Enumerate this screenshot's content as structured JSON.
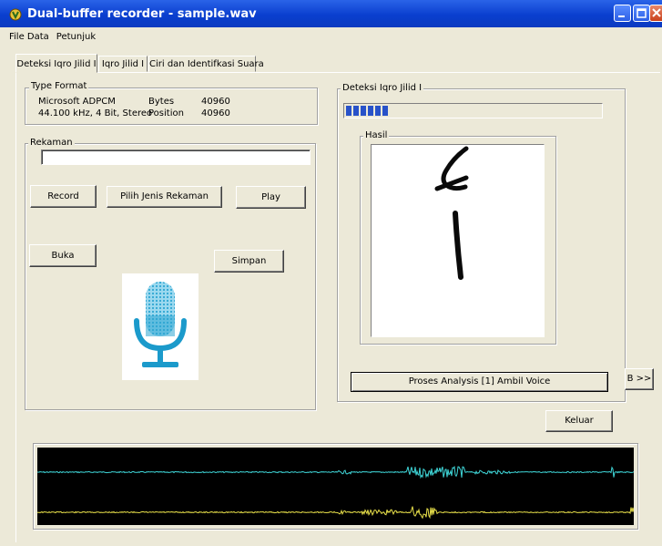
{
  "window": {
    "title": "Dual-buffer recorder - sample.wav",
    "icon": "app-icon",
    "title_bar_color": "#0a3fcf"
  },
  "menu": [
    "File Data",
    "Petunjuk"
  ],
  "tabs": [
    "Deteksi Iqro Jilid I",
    "Iqro Jilid I",
    "Ciri dan Identifkasi Suara"
  ],
  "type_format": {
    "label": "Type Format",
    "format": "Microsoft ADPCM",
    "detail": "44.100 kHz, 4 Bit, Stereo",
    "bytes_label": "Bytes",
    "bytes_value": "40960",
    "position_label": "Position",
    "position_value": "40960"
  },
  "rekaman": {
    "label": "Rekaman",
    "field_value": "",
    "record": "Record",
    "pilih": "Pilih Jenis Rekaman",
    "play": "Play",
    "buka": "Buka",
    "simpan": "Simpan",
    "mic_icon": "microphone-icon"
  },
  "deteksi": {
    "label": "Deteksi Iqro Jilid I",
    "progress_fraction": 0.19,
    "progress_color": "#2852c9",
    "hasil_label": "Hasil",
    "proses_button": "Proses Analysis [1] Ambil Voice"
  },
  "b_button": "B >>",
  "keluar": "Keluar",
  "waveform": {
    "background": "#000000",
    "channel_colors": [
      "#3fd6d8",
      "#e8e04a"
    ]
  }
}
